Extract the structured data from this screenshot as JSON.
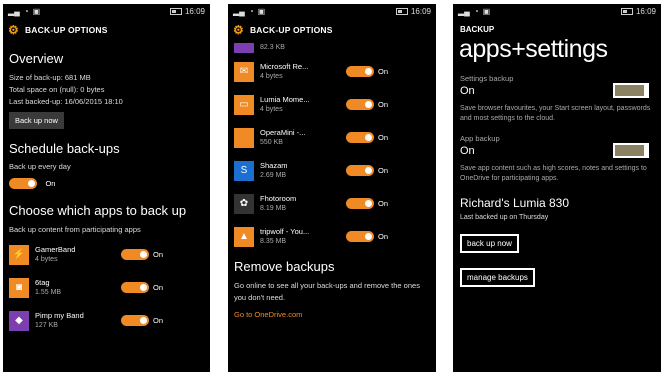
{
  "screens": {
    "s1": {
      "status": {
        "time": "16:09"
      },
      "title": "BACK-UP OPTIONS",
      "overview": {
        "heading": "Overview",
        "size": "Size of back-up: 681 MB",
        "total_space": "Total space on (null): 0 bytes",
        "last_backed": "Last backed-up: 16/06/2015 18:10",
        "button": "Back up now"
      },
      "schedule": {
        "heading": "Schedule back-ups",
        "label": "Back up every day",
        "state": "On"
      },
      "choose": {
        "heading": "Choose which apps to back up",
        "subtitle": "Back up content from participating apps"
      },
      "apps": [
        {
          "name": "GamerBand",
          "size": "4 bytes",
          "state": "On",
          "icon": "gamerband-icon",
          "glyph": "⚡"
        },
        {
          "name": "6tag",
          "size": "1.55 MB",
          "state": "On",
          "icon": "6tag-icon",
          "glyph": "◙"
        },
        {
          "name": "Pimp my Band",
          "size": "127 KB",
          "state": "On",
          "icon": "pimp-my-band-icon",
          "glyph": "◆"
        }
      ]
    },
    "s2": {
      "status": {
        "time": "16:09"
      },
      "title": "BACK-UP OPTIONS",
      "top_size": "82.3 KB",
      "apps": [
        {
          "name": "Microsoft Re...",
          "size": "4 bytes",
          "state": "On",
          "icon": "microsoft-re-icon",
          "glyph": "✉"
        },
        {
          "name": "Lumia Mome...",
          "size": "4 bytes",
          "state": "On",
          "icon": "lumia-moments-icon",
          "glyph": "▭"
        },
        {
          "name": "OperaMini -...",
          "size": "550 KB",
          "state": "On",
          "icon": "operamini-icon",
          "glyph": ""
        },
        {
          "name": "Shazam",
          "size": "2.69 MB",
          "state": "On",
          "icon": "shazam-icon",
          "glyph": "S"
        },
        {
          "name": "Fhotoroom",
          "size": "8.19 MB",
          "state": "On",
          "icon": "fhotoroom-icon",
          "glyph": "✿"
        },
        {
          "name": "tripwolf - You...",
          "size": "8.35 MB",
          "state": "On",
          "icon": "tripwolf-icon",
          "glyph": "▲"
        }
      ],
      "remove": {
        "heading": "Remove backups",
        "text": "Go online to see all your back-ups and remove the ones you don't need.",
        "link": "Go to OneDrive.com"
      }
    },
    "s3": {
      "status": {
        "time": "16:09"
      },
      "header": "BACKUP",
      "title": "apps+settings",
      "settings": {
        "label": "Settings backup",
        "value": "On",
        "desc": "Save browser favourites, your Start screen layout, passwords and most settings to the cloud."
      },
      "app": {
        "label": "App backup",
        "value": "On",
        "desc": "Save app content such as high scores, notes and settings to OneDrive for participating apps."
      },
      "device": {
        "name": "Richard's Lumia 830",
        "last": "Last backed up on Thursday"
      },
      "back_up_now": "back up now",
      "manage": "manage backups"
    }
  },
  "colors": {
    "accent": "#f08a24",
    "background": "#000000"
  }
}
